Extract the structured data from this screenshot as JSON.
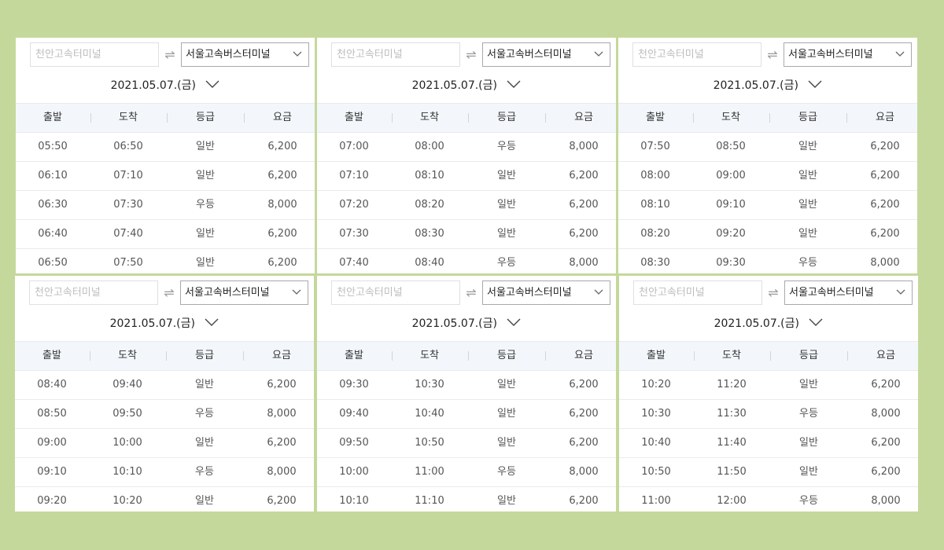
{
  "search": {
    "origin_placeholder": "천안고속터미널",
    "swap_symbol": "⇌",
    "destination": "서울고속버스터미널"
  },
  "date": "2021.05.07.(금)",
  "columns": [
    "출발",
    "도착",
    "등급",
    "요금"
  ],
  "panels": [
    {
      "rows": [
        [
          "05:50",
          "06:50",
          "일반",
          "6,200"
        ],
        [
          "06:10",
          "07:10",
          "일반",
          "6,200"
        ],
        [
          "06:30",
          "07:30",
          "우등",
          "8,000"
        ],
        [
          "06:40",
          "07:40",
          "일반",
          "6,200"
        ],
        [
          "06:50",
          "07:50",
          "일반",
          "6,200"
        ]
      ]
    },
    {
      "rows": [
        [
          "07:00",
          "08:00",
          "우등",
          "8,000"
        ],
        [
          "07:10",
          "08:10",
          "일반",
          "6,200"
        ],
        [
          "07:20",
          "08:20",
          "일반",
          "6,200"
        ],
        [
          "07:30",
          "08:30",
          "일반",
          "6,200"
        ],
        [
          "07:40",
          "08:40",
          "우등",
          "8,000"
        ]
      ]
    },
    {
      "rows": [
        [
          "07:50",
          "08:50",
          "일반",
          "6,200"
        ],
        [
          "08:00",
          "09:00",
          "일반",
          "6,200"
        ],
        [
          "08:10",
          "09:10",
          "일반",
          "6,200"
        ],
        [
          "08:20",
          "09:20",
          "일반",
          "6,200"
        ],
        [
          "08:30",
          "09:30",
          "우등",
          "8,000"
        ]
      ]
    },
    {
      "rows": [
        [
          "08:40",
          "09:40",
          "일반",
          "6,200"
        ],
        [
          "08:50",
          "09:50",
          "우등",
          "8,000"
        ],
        [
          "09:00",
          "10:00",
          "일반",
          "6,200"
        ],
        [
          "09:10",
          "10:10",
          "우등",
          "8,000"
        ],
        [
          "09:20",
          "10:20",
          "일반",
          "6,200"
        ]
      ]
    },
    {
      "rows": [
        [
          "09:30",
          "10:30",
          "일반",
          "6,200"
        ],
        [
          "09:40",
          "10:40",
          "일반",
          "6,200"
        ],
        [
          "09:50",
          "10:50",
          "일반",
          "6,200"
        ],
        [
          "10:00",
          "11:00",
          "우등",
          "8,000"
        ],
        [
          "10:10",
          "11:10",
          "일반",
          "6,200"
        ]
      ]
    },
    {
      "rows": [
        [
          "10:20",
          "11:20",
          "일반",
          "6,200"
        ],
        [
          "10:30",
          "11:30",
          "우등",
          "8,000"
        ],
        [
          "10:40",
          "11:40",
          "일반",
          "6,200"
        ],
        [
          "10:50",
          "11:50",
          "일반",
          "6,200"
        ],
        [
          "11:00",
          "12:00",
          "우등",
          "8,000"
        ]
      ]
    }
  ],
  "colors": {
    "background": "#c5d89b",
    "header_bg": "#f3f7fb"
  },
  "icons": {
    "swap": "swap-arrows-icon",
    "dropdown": "chevron-down-icon"
  }
}
